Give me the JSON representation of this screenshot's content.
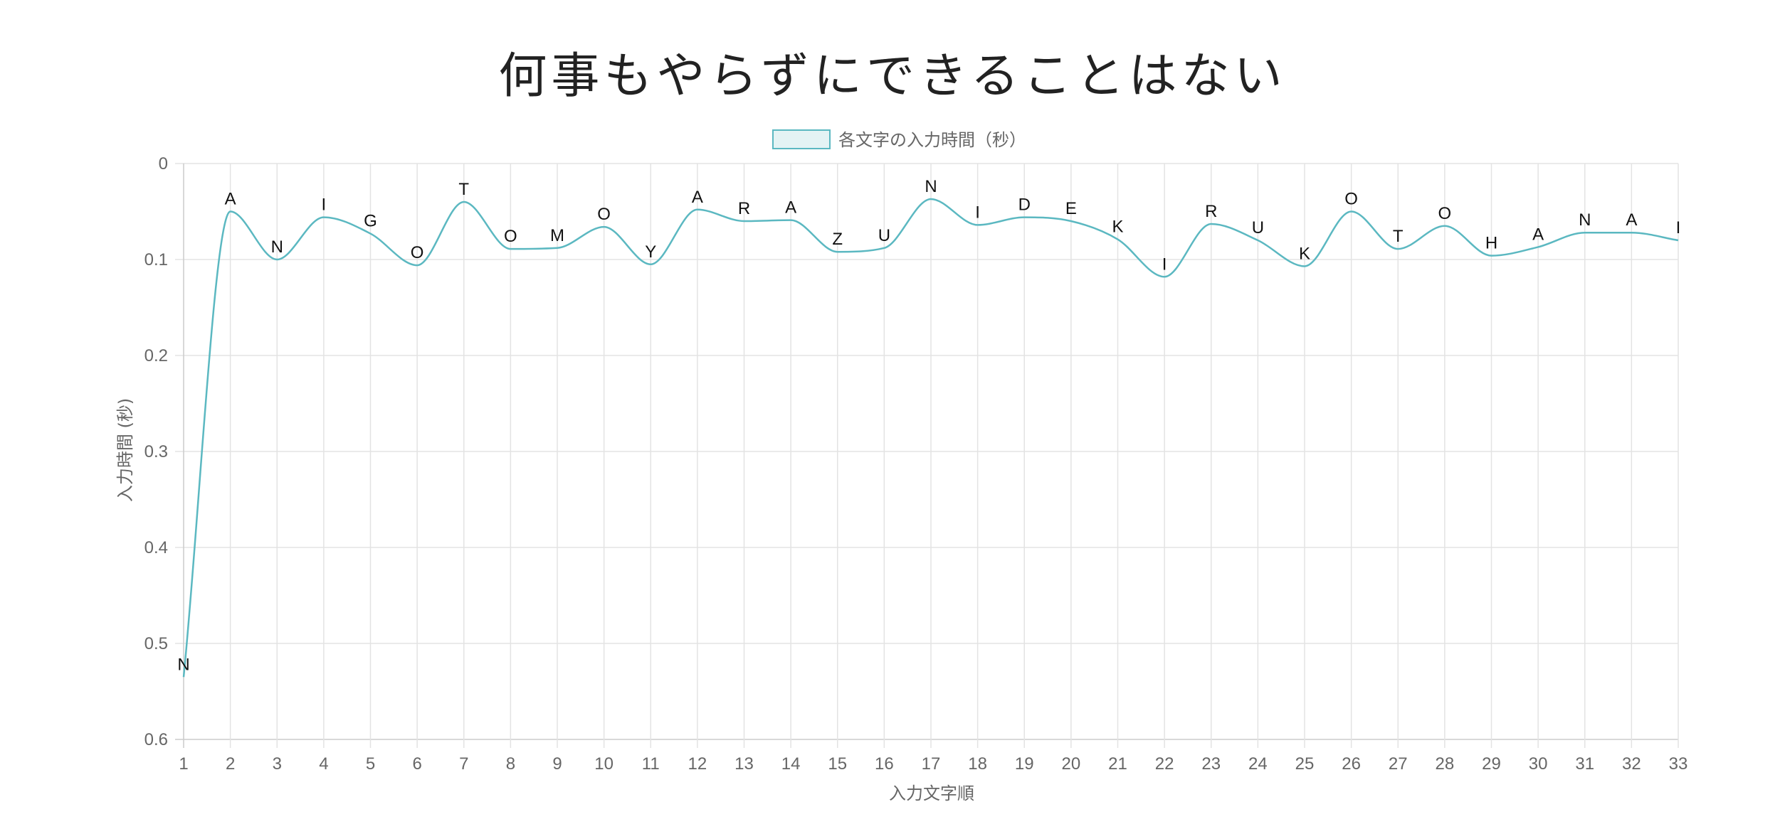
{
  "chart_data": {
    "type": "line",
    "title": "何事もやらずにできることはない",
    "legend": {
      "position": "top",
      "entries": [
        "各文字の入力時間（秒）"
      ]
    },
    "xlabel": "入力文字順",
    "ylabel": "入力時間 (秒)",
    "y_reversed": true,
    "ylim": [
      0,
      0.6
    ],
    "y_ticks": [
      "0",
      "0.1",
      "0.2",
      "0.3",
      "0.4",
      "0.5",
      "0.6"
    ],
    "grid": true,
    "colors": {
      "line": "#5bb8c1",
      "legend_fill": "#e4f3f4",
      "grid": "#e3e3e3",
      "axis": "#cccccc"
    },
    "x": [
      1,
      2,
      3,
      4,
      5,
      6,
      7,
      8,
      9,
      10,
      11,
      12,
      13,
      14,
      15,
      16,
      17,
      18,
      19,
      20,
      21,
      22,
      23,
      24,
      25,
      26,
      27,
      28,
      29,
      30,
      31,
      32,
      33
    ],
    "series": [
      {
        "name": "各文字の入力時間（秒）",
        "values": [
          0.535,
          0.05,
          0.1,
          0.056,
          0.073,
          0.106,
          0.04,
          0.089,
          0.088,
          0.066,
          0.105,
          0.048,
          0.06,
          0.059,
          0.092,
          0.088,
          0.037,
          0.064,
          0.056,
          0.06,
          0.079,
          0.118,
          0.063,
          0.08,
          0.107,
          0.05,
          0.089,
          0.065,
          0.096,
          0.087,
          0.072,
          0.072,
          0.08
        ],
        "point_labels": [
          "N",
          "A",
          "N",
          "I",
          "G",
          "O",
          "T",
          "O",
          "M",
          "O",
          "Y",
          "A",
          "R",
          "A",
          "Z",
          "U",
          "N",
          "I",
          "D",
          "E",
          "K",
          "I",
          "R",
          "U",
          "K",
          "O",
          "T",
          "O",
          "H",
          "A",
          "N",
          "A",
          "I"
        ]
      }
    ]
  }
}
